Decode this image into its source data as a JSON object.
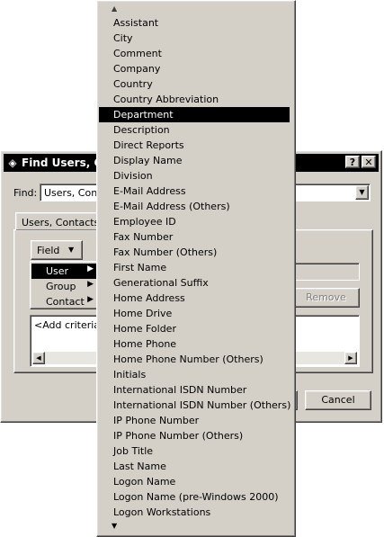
{
  "dialog": {
    "title": "Find Users, Con",
    "help_label": "?",
    "close_label": "✕",
    "find_label": "Find:",
    "find_value": "Users, Conta",
    "tab_label": "Users, Contacts, a",
    "field_button": "Field",
    "remove_button": "Remove",
    "criteria_placeholder": "<Add criteria fr",
    "cancel_button": "Cancel"
  },
  "submenu": {
    "items": [
      {
        "label": "User",
        "highlighted": true
      },
      {
        "label": "Group",
        "highlighted": false
      },
      {
        "label": "Contact",
        "highlighted": false
      }
    ]
  },
  "menu": {
    "selected": "Department",
    "items": [
      "Assistant",
      "City",
      "Comment",
      "Company",
      "Country",
      "Country Abbreviation",
      "Department",
      "Description",
      "Direct Reports",
      "Display Name",
      "Division",
      "E-Mail Address",
      "E-Mail Address (Others)",
      "Employee ID",
      "Fax Number",
      "Fax Number (Others)",
      "First Name",
      "Generational Suffix",
      "Home Address",
      "Home Drive",
      "Home Folder",
      "Home Phone",
      "Home Phone Number (Others)",
      "Initials",
      "International ISDN Number",
      "International ISDN Number (Others)",
      "IP Phone Number",
      "IP Phone Number (Others)",
      "Job Title",
      "Last Name",
      "Logon Name",
      "Logon Name (pre-Windows 2000)",
      "Logon Workstations"
    ]
  },
  "icons": {
    "up_arrow": "▲",
    "down_arrow": "▼",
    "right_arrow": "▶",
    "left_arrow": "◀"
  }
}
